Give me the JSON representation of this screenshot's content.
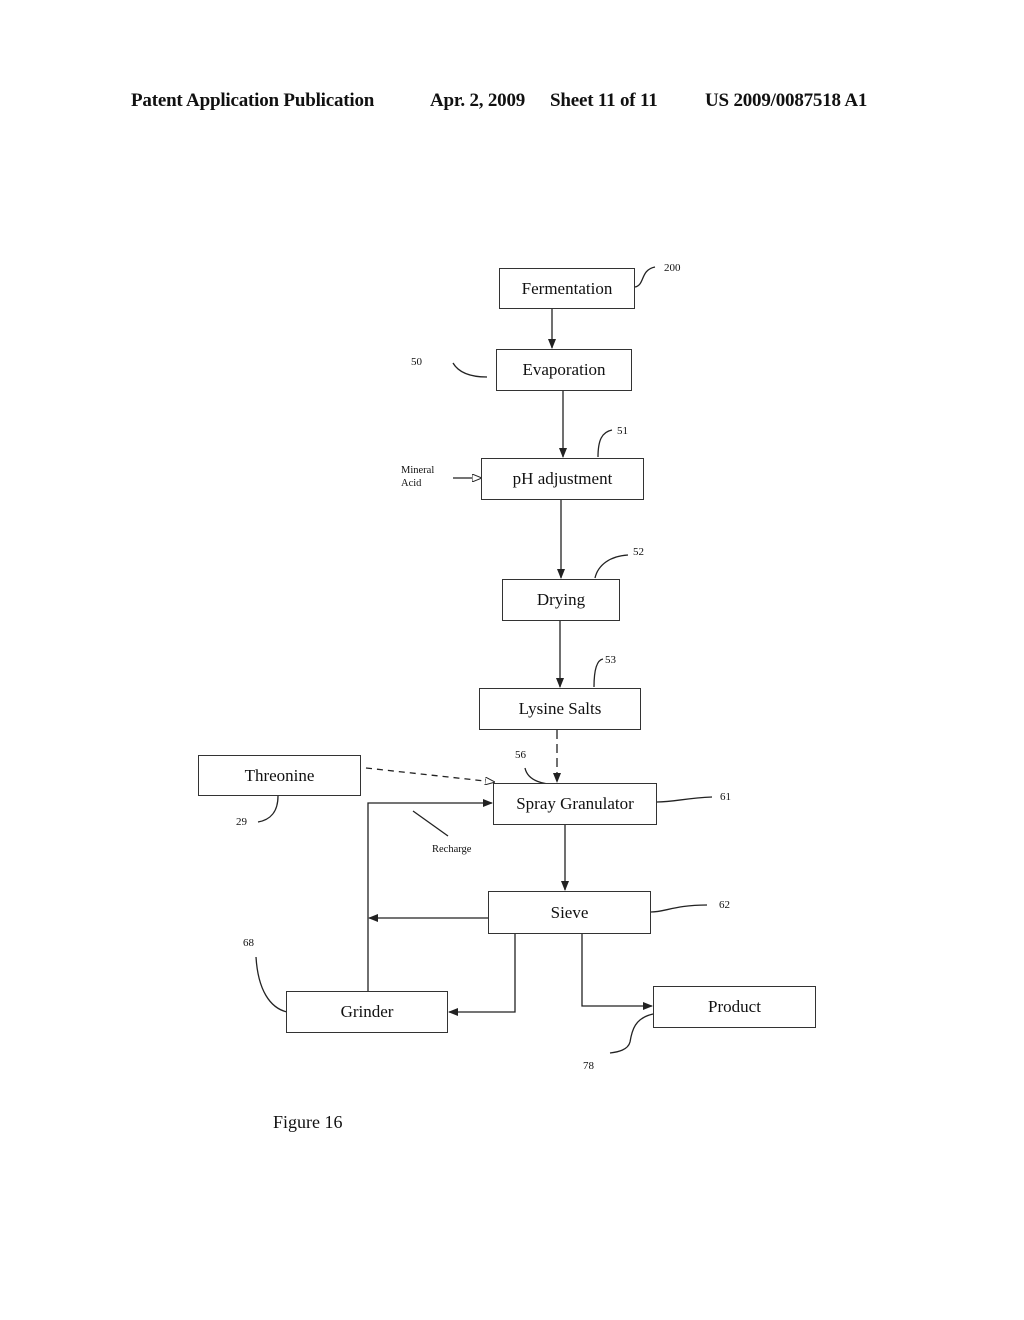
{
  "header": {
    "publication": "Patent Application Publication",
    "date": "Apr. 2, 2009",
    "sheet": "Sheet 11 of 11",
    "number": "US 2009/0087518 A1"
  },
  "nodes": {
    "fermentation": {
      "label": "Fermentation",
      "ref": "200"
    },
    "evaporation": {
      "label": "Evaporation",
      "ref": "50"
    },
    "ph_adjustment": {
      "label": "pH adjustment",
      "ref": "51"
    },
    "drying": {
      "label": "Drying",
      "ref": "52"
    },
    "lysine_salts": {
      "label": "Lysine Salts",
      "ref": "53"
    },
    "threonine": {
      "label": "Threonine",
      "ref": "29"
    },
    "spray_granulator": {
      "label": "Spray Granulator",
      "ref": "61"
    },
    "sieve": {
      "label": "Sieve",
      "ref": "62"
    },
    "grinder": {
      "label": "Grinder",
      "ref": "68"
    },
    "product": {
      "label": "Product",
      "ref": "78"
    }
  },
  "inputs": {
    "mineral_acid_line1": "Mineral",
    "mineral_acid_line2": "Acid",
    "inlet_ref": "56"
  },
  "annotations": {
    "recharge": "Recharge"
  },
  "edges": [
    {
      "from": "fermentation",
      "to": "evaporation",
      "style": "solid"
    },
    {
      "from": "evaporation",
      "to": "ph_adjustment",
      "style": "solid"
    },
    {
      "from": "mineral_acid",
      "to": "ph_adjustment",
      "style": "solid"
    },
    {
      "from": "ph_adjustment",
      "to": "drying",
      "style": "solid"
    },
    {
      "from": "drying",
      "to": "lysine_salts",
      "style": "solid"
    },
    {
      "from": "lysine_salts",
      "to": "spray_granulator",
      "style": "dashed"
    },
    {
      "from": "threonine",
      "to": "spray_granulator",
      "style": "dashed"
    },
    {
      "from": "spray_granulator",
      "to": "sieve",
      "style": "solid"
    },
    {
      "from": "sieve",
      "to": "grinder",
      "style": "solid"
    },
    {
      "from": "sieve",
      "to": "product",
      "style": "solid"
    },
    {
      "from": "sieve",
      "to": "recharge_line",
      "style": "solid"
    },
    {
      "from": "grinder",
      "to": "spray_granulator",
      "style": "solid",
      "label": "Recharge"
    }
  ],
  "figure_label": "Figure 16"
}
